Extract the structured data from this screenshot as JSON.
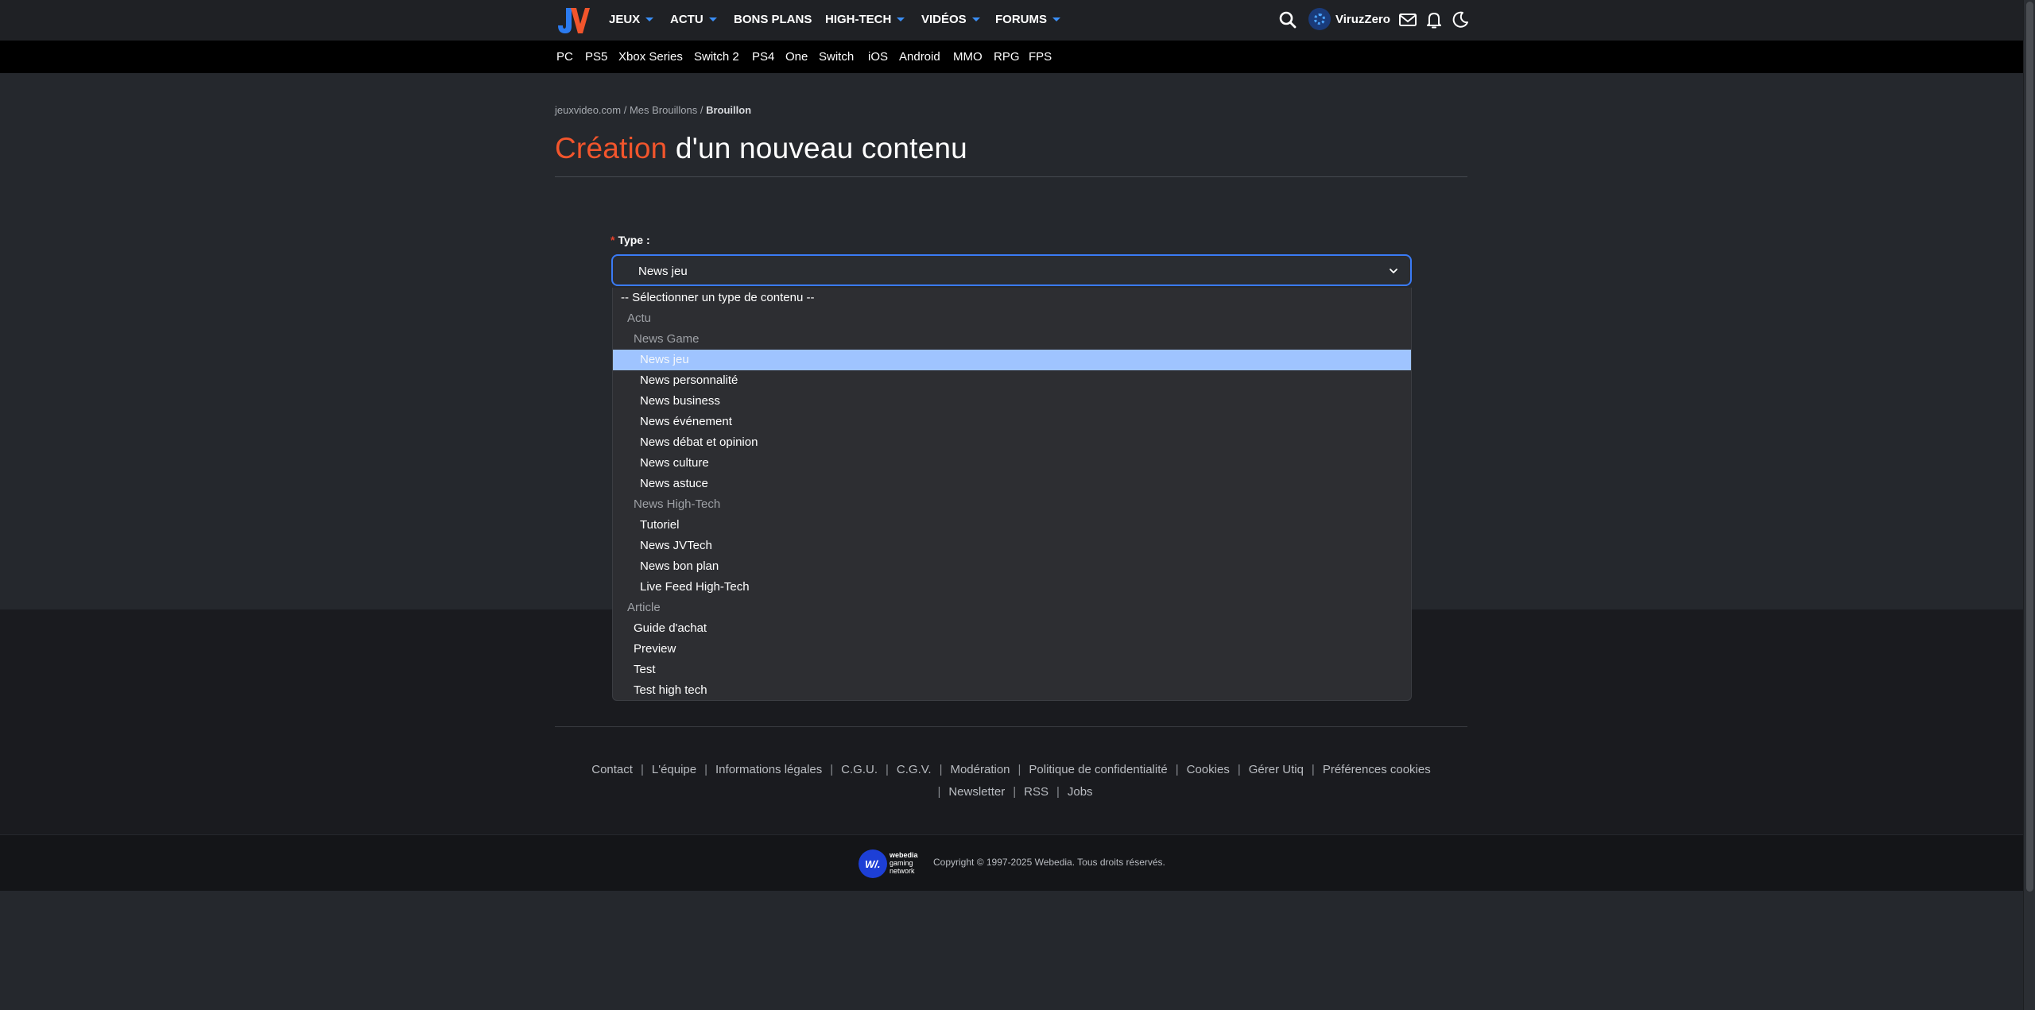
{
  "nav": {
    "logo": "JV",
    "items": [
      {
        "label": "JEUX",
        "caret": true
      },
      {
        "label": "ACTU",
        "caret": true
      },
      {
        "label": "BONS PLANS",
        "caret": false
      },
      {
        "label": "HIGH-TECH",
        "caret": true
      },
      {
        "label": "VIDÉOS",
        "caret": true
      },
      {
        "label": "FORUMS",
        "caret": true
      }
    ],
    "username": "ViruzZero",
    "icons": [
      "search-icon",
      "avatar",
      "mail-icon",
      "bell-icon",
      "moon-icon"
    ],
    "accent_color": "#3a8ef6"
  },
  "platforms": [
    "PC",
    "PS5",
    "Xbox Series",
    "Switch 2",
    "PS4",
    "One",
    "Switch",
    "iOS",
    "Android",
    "MMO",
    "RPG",
    "FPS"
  ],
  "breadcrumb": {
    "items": [
      "jeuxvideo.com",
      "Mes Brouillons"
    ],
    "current": "Brouillon"
  },
  "page_title": {
    "accent": "Création",
    "rest": " d'un nouveau contenu",
    "accent_color": "#f2552c"
  },
  "form": {
    "type_label": "Type :",
    "required_mark": "*",
    "selected_value": "News jeu",
    "options": [
      {
        "label": "-- Sélectionner un type de contenu --",
        "kind": "option",
        "level": 0
      },
      {
        "label": "Actu",
        "kind": "group",
        "level": 1
      },
      {
        "label": "News Game",
        "kind": "group",
        "level": 2
      },
      {
        "label": "News jeu",
        "kind": "option",
        "level": 3,
        "selected": true
      },
      {
        "label": "News personnalité",
        "kind": "option",
        "level": 3
      },
      {
        "label": "News business",
        "kind": "option",
        "level": 3
      },
      {
        "label": "News événement",
        "kind": "option",
        "level": 3
      },
      {
        "label": "News débat et opinion",
        "kind": "option",
        "level": 3
      },
      {
        "label": "News culture",
        "kind": "option",
        "level": 3
      },
      {
        "label": "News astuce",
        "kind": "option",
        "level": 3
      },
      {
        "label": "News High-Tech",
        "kind": "group",
        "level": 2
      },
      {
        "label": "Tutoriel",
        "kind": "option",
        "level": 3
      },
      {
        "label": "News JVTech",
        "kind": "option",
        "level": 3
      },
      {
        "label": "News bon plan",
        "kind": "option",
        "level": 3
      },
      {
        "label": "Live Feed High-Tech",
        "kind": "option",
        "level": 3
      },
      {
        "label": "Article",
        "kind": "group",
        "level": 1
      },
      {
        "label": "Guide d'achat",
        "kind": "option",
        "level": 2
      },
      {
        "label": "Preview",
        "kind": "option",
        "level": 2
      },
      {
        "label": "Test",
        "kind": "option",
        "level": 2
      },
      {
        "label": "Test high tech",
        "kind": "option",
        "level": 2
      }
    ]
  },
  "footer": {
    "links_row1": [
      "Contact",
      "L'équipe",
      "Informations légales",
      "C.G.U.",
      "C.G.V.",
      "Modération",
      "Politique de confidentialité",
      "Cookies",
      "Gérer Utiq",
      "Préférences cookies"
    ],
    "links_row2": [
      "Newsletter",
      "RSS",
      "Jobs"
    ],
    "brand": "webedia gaming network",
    "copyright": "Copyright © 1997-2025 Webedia. Tous droits réservés."
  }
}
